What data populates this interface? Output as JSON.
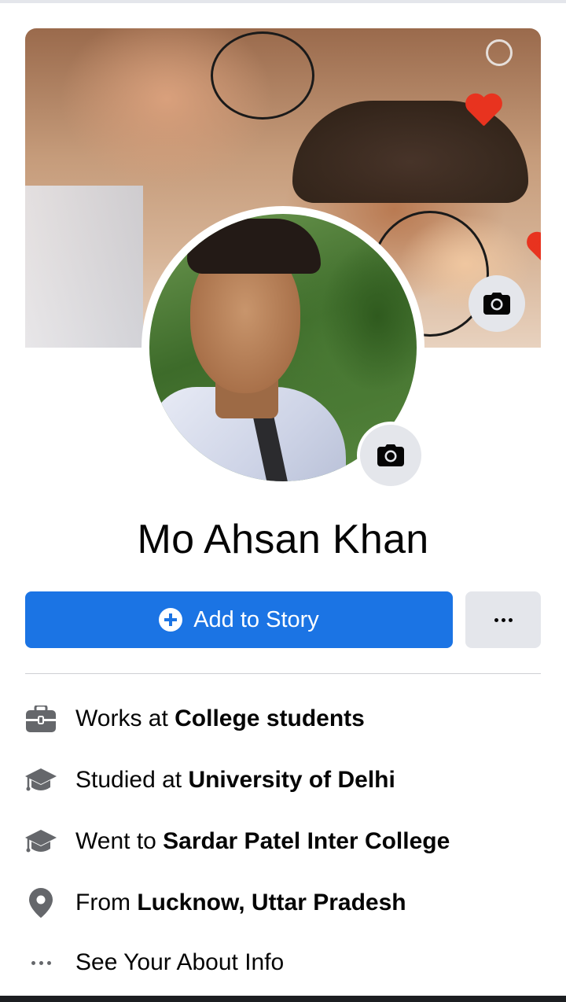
{
  "profile": {
    "name": "Mo Ahsan Khan"
  },
  "actions": {
    "add_to_story_label": "Add to Story"
  },
  "intro": {
    "items": [
      {
        "icon": "briefcase-icon",
        "prefix": "Works at ",
        "value": "College students"
      },
      {
        "icon": "graduation-cap-icon",
        "prefix": "Studied at ",
        "value": "University of Delhi"
      },
      {
        "icon": "graduation-cap-icon",
        "prefix": "Went to ",
        "value": "Sardar Patel Inter College"
      },
      {
        "icon": "location-pin-icon",
        "prefix": "From ",
        "value": "Lucknow, Uttar Pradesh"
      }
    ],
    "see_about_label": "See Your About Info"
  },
  "colors": {
    "primary": "#1b74e4",
    "secondary_button": "#e4e6eb",
    "icon_gray": "#65676b",
    "text": "#050505"
  }
}
